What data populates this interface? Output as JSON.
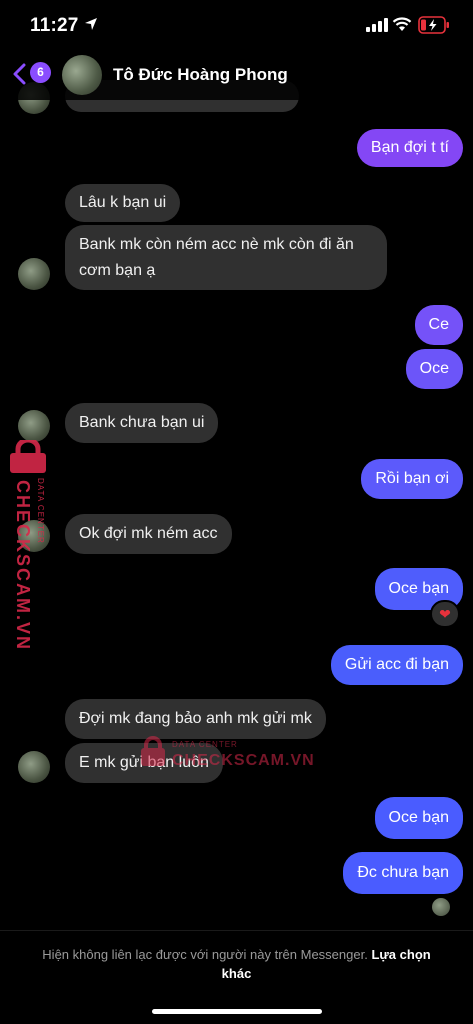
{
  "status_bar": {
    "time": "11:27"
  },
  "header": {
    "back_count": "6",
    "contact_name": "Tô Đức Hoàng Phong"
  },
  "messages": [
    {
      "dir": "out",
      "text": "Bạn đợi t tí"
    },
    {
      "dir": "in",
      "text": "Lâu k bạn ui"
    },
    {
      "dir": "in",
      "text": "Bank mk còn ném acc nè mk còn đi ăn\ncơm bạn ạ"
    },
    {
      "dir": "out",
      "text": "Ce"
    },
    {
      "dir": "out",
      "text": "Oce"
    },
    {
      "dir": "in",
      "text": "Bank chưa bạn ui"
    },
    {
      "dir": "out",
      "text": "Rồi bạn ơi"
    },
    {
      "dir": "in",
      "text": "Ok đợi mk ném acc"
    },
    {
      "dir": "out",
      "text": "Oce bạn"
    },
    {
      "dir": "out",
      "text": "Gửi acc đi bạn"
    },
    {
      "dir": "in",
      "text": "Đợi mk đang bảo anh mk gửi mk"
    },
    {
      "dir": "in",
      "text": "E mk gửi bạn luôn"
    },
    {
      "dir": "out",
      "text": "Oce bạn"
    },
    {
      "dir": "out",
      "text": "Đc chưa bạn"
    }
  ],
  "reaction": {
    "emoji": "❤"
  },
  "watermark": {
    "brand": "CHECKSCAM.VN",
    "sub": "DATA CENTER"
  },
  "footer": {
    "notice": "Hiện không liên lạc được với người này trên Messenger.",
    "link": "Lựa chọn khác"
  },
  "colors": {
    "purple": "#8a4dff",
    "blue": "#4a5cff",
    "incoming": "#303030"
  }
}
